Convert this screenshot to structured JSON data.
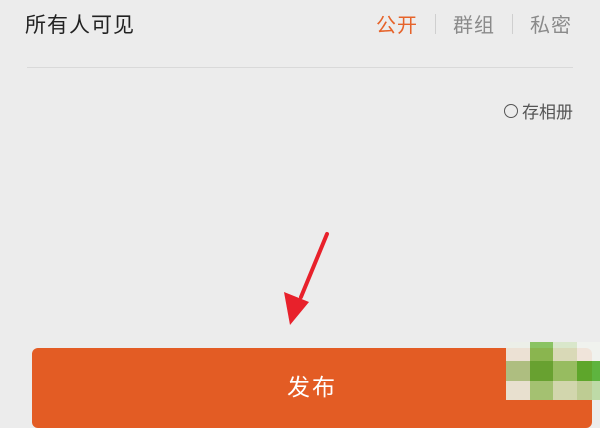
{
  "visibility": {
    "label": "所有人可见",
    "tabs": [
      {
        "label": "公开",
        "active": true
      },
      {
        "label": "群组",
        "active": false
      },
      {
        "label": "私密",
        "active": false
      }
    ]
  },
  "save_album": {
    "label": "存相册",
    "checked": false
  },
  "publish": {
    "label": "发布"
  },
  "colors": {
    "accent": "#e6632a",
    "button": "#e35c24",
    "background": "#ececec",
    "arrow": "#e8212b"
  }
}
